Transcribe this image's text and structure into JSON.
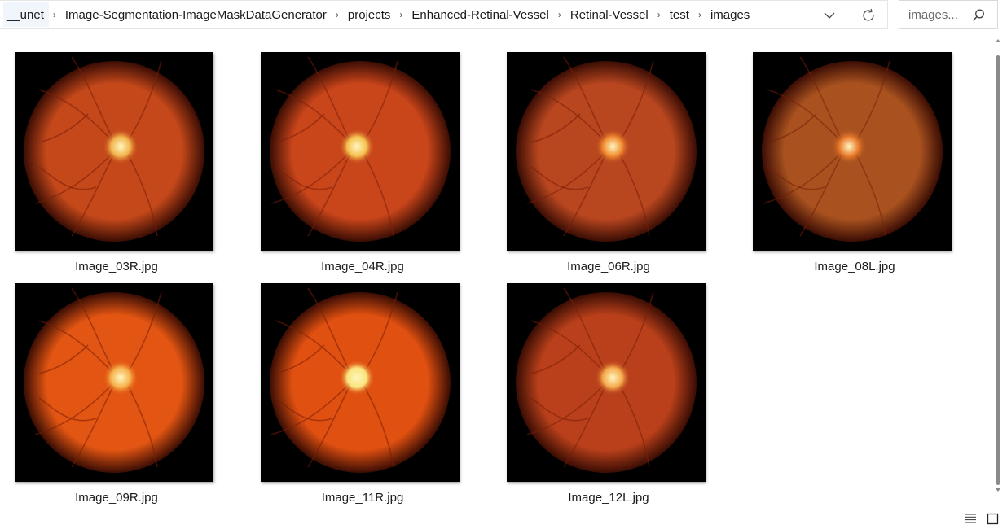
{
  "breadcrumb": {
    "items": [
      "__unet",
      "Image-Segmentation-ImageMaskDataGenerator",
      "projects",
      "Enhanced-Retinal-Vessel",
      "Retinal-Vessel",
      "test",
      "images"
    ],
    "separator": "›"
  },
  "search": {
    "placeholder": "images..."
  },
  "icons": {
    "dropdown": "chevron-down-icon",
    "refresh": "refresh-icon",
    "search": "search-icon",
    "details_view": "details-view-icon",
    "large_icons_view": "large-icons-view-icon"
  },
  "files": [
    {
      "name": "Image_03R.jpg",
      "tint": "#c4481a",
      "disc": "#f2b24a"
    },
    {
      "name": "Image_04R.jpg",
      "tint": "#c9451a",
      "disc": "#f4c04e"
    },
    {
      "name": "Image_06R.jpg",
      "tint": "#b8461f",
      "disc": "#f08a2e"
    },
    {
      "name": "Image_08L.jpg",
      "tint": "#a9521f",
      "disc": "#e9792a"
    },
    {
      "name": "Image_09R.jpg",
      "tint": "#e25512",
      "disc": "#f6b04a"
    },
    {
      "name": "Image_11R.jpg",
      "tint": "#e05010",
      "disc": "#f9e37a"
    },
    {
      "name": "Image_12L.jpg",
      "tint": "#b9401a",
      "disc": "#f5a84a"
    }
  ],
  "colors": {
    "window_bg": "#ffffff",
    "thumb_bg": "#000000",
    "crumb_highlight": "#f0f6fc"
  }
}
